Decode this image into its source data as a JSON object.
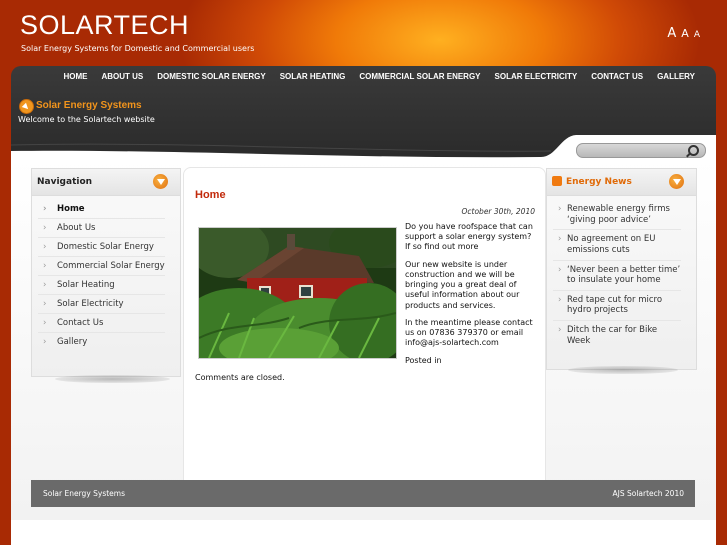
{
  "header": {
    "site_title": "SOLARTECH",
    "tagline": "Solar Energy Systems for Domestic and Commercial users",
    "font_sizer": [
      "A",
      "A",
      "A"
    ]
  },
  "nav": {
    "items": [
      "HOME",
      "ABOUT US",
      "DOMESTIC SOLAR ENERGY",
      "SOLAR HEATING",
      "COMMERCIAL SOLAR ENERGY",
      "SOLAR ELECTRICITY",
      "CONTACT US",
      "GALLERY"
    ]
  },
  "banner": {
    "title": "Solar Energy Systems",
    "subtitle": "Welcome to the Solartech website"
  },
  "search": {
    "placeholder": ""
  },
  "sidebar": {
    "title": "Navigation",
    "items": [
      "Home",
      "About Us",
      "Domestic Solar Energy",
      "Commercial Solar Energy",
      "Solar Heating",
      "Solar Electricity",
      "Contact Us",
      "Gallery"
    ]
  },
  "news": {
    "title": "Energy News",
    "items": [
      "Renewable energy firms ‘giving poor advice’",
      "No agreement on EU emissions cuts",
      "‘Never been a better time’ to insulate your home",
      "Red tape cut for micro hydro projects",
      "Ditch the car for Bike Week"
    ]
  },
  "post": {
    "title": "Home",
    "date": "October 30th, 2010",
    "paragraphs": [
      "Do you have roofspace that can support a solar energy system? If so find out more",
      "Our new website is under construction and we will be bringing you a great deal of useful information about our products and services.",
      "In the meantime please contact us on 07836 379370 or email info@ajs-solartech.com",
      "Posted in"
    ],
    "comments": "Comments are closed."
  },
  "footer": {
    "left": "Solar Energy Systems",
    "right": "AJS Solartech 2010"
  },
  "colors": {
    "accent": "#f2941c",
    "title_red": "#c2290a",
    "dark_band": "#2f2f2f"
  }
}
